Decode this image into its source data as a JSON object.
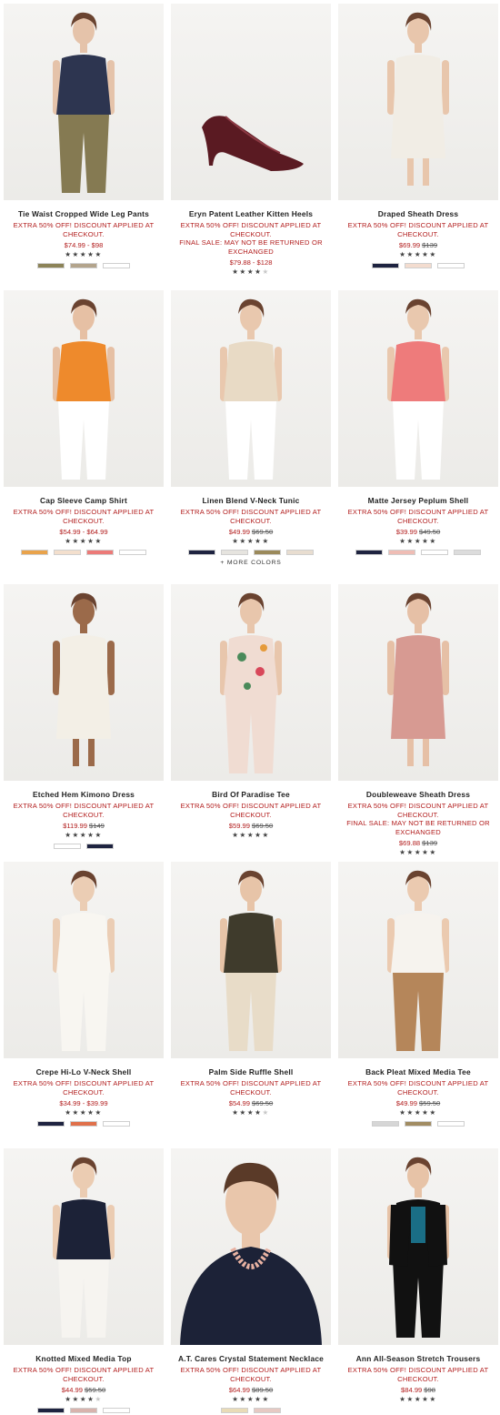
{
  "promo": "EXTRA 50% OFF! DISCOUNT APPLIED AT CHECKOUT.",
  "final_sale": "FINAL SALE: MAY NOT BE RETURNED OR EXCHANGED",
  "more_colors": "+ MORE COLORS",
  "products": [
    {
      "name": "Tie Waist Cropped Wide Leg Pants",
      "price": "$74.99 - $98",
      "was": "",
      "rating": 4.5,
      "swatches": [
        "#8c8358",
        "#b3a48c",
        "#ffffff"
      ]
    },
    {
      "name": "Eryn Patent Leather Kitten Heels",
      "price": "$79.88 - $128",
      "was": "",
      "rating": 3.5,
      "final": true,
      "swatches": []
    },
    {
      "name": "Draped Sheath Dress",
      "price": "$69.99",
      "was": "$139",
      "rating": 4.5,
      "swatches": [
        "#1e2340",
        "#f3dccf",
        "#ffffff"
      ]
    },
    {
      "name": "Cap Sleeve Camp Shirt",
      "price": "$54.99 - $64.99",
      "was": "",
      "rating": 4.5,
      "swatches": [
        "#e9a34b",
        "#f3dfcd",
        "#ec7a78",
        "#ffffff"
      ]
    },
    {
      "name": "Linen Blend V-Neck Tunic",
      "price": "$49.99",
      "was": "$69.50",
      "rating": 4.5,
      "more": true,
      "swatches": [
        "#1e2340",
        "#e6e4df",
        "#9b8a5b",
        "#e8ddd0"
      ]
    },
    {
      "name": "Matte Jersey Peplum Shell",
      "price": "$39.99",
      "was": "$49.50",
      "rating": 4.5,
      "swatches": [
        "#1e2340",
        "#efbdb5",
        "#ffffff",
        "#dcdcdc"
      ]
    },
    {
      "name": "Etched Hem Kimono Dress",
      "price": "$119.99",
      "was": "$149",
      "rating": 4.5,
      "swatches": [
        "#ffffff",
        "#1e2340"
      ]
    },
    {
      "name": "Bird Of Paradise Tee",
      "price": "$59.99",
      "was": "$69.50",
      "rating": 4.5,
      "swatches": []
    },
    {
      "name": "Doubleweave Sheath Dress",
      "price": "$69.88",
      "was": "$139",
      "rating": 4.5,
      "final": true,
      "swatches": []
    },
    {
      "name": "Crepe Hi-Lo V-Neck Shell",
      "price": "$34.99 - $39.99",
      "was": "",
      "rating": 4.5,
      "swatches": [
        "#1e2340",
        "#e0704a",
        "#ffffff"
      ]
    },
    {
      "name": "Palm Side Ruffle Shell",
      "price": "$54.99",
      "was": "$69.50",
      "rating": 3.5,
      "swatches": []
    },
    {
      "name": "Back Pleat Mixed Media Tee",
      "price": "$49.99",
      "was": "$59.50",
      "rating": 4.5,
      "swatches": [
        "#d6d6d6",
        "#a18c62",
        "#ffffff"
      ]
    },
    {
      "name": "Knotted Mixed Media Top",
      "price": "$44.99",
      "was": "$59.50",
      "rating": 4.0,
      "swatches": [
        "#1e2340",
        "#d8b3ad",
        "#ffffff"
      ]
    },
    {
      "name": "A.T. Cares Crystal Statement Necklace",
      "price": "$64.99",
      "was": "$89.50",
      "rating": 5,
      "swatches": [
        "#e9dbb7",
        "#e6c9c3"
      ]
    },
    {
      "name": "Ann All-Season Stretch Trousers",
      "price": "$84.99",
      "was": "$98",
      "rating": 4.5,
      "swatches": []
    }
  ]
}
